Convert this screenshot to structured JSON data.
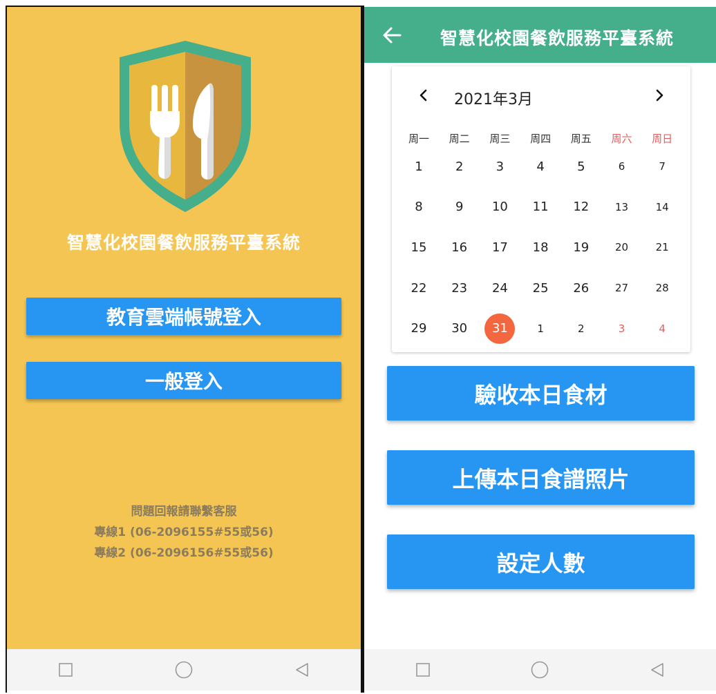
{
  "left_screen": {
    "app_title": "智慧化校園餐飲服務平臺系統",
    "buttons": {
      "cloud_login": "教育雲端帳號登入",
      "general_login": "一般登入"
    },
    "support": {
      "line0": "問題回報請聯繫客服",
      "line1": "專線1 (06-2096155#55或56)",
      "line2": "專線2 (06-2096156#55或56)"
    },
    "logo_icon": "shield-fork-knife-logo",
    "colors": {
      "background": "#f4c552",
      "button": "#2796f3",
      "shield": "#45ae8a"
    }
  },
  "right_screen": {
    "app_title": "智慧化校園餐飲服務平臺系統",
    "back_icon": "arrow-left-icon",
    "calendar": {
      "month_label": "2021年3月",
      "weekdays": [
        "周一",
        "周二",
        "周三",
        "周四",
        "周五",
        "周六",
        "周日"
      ],
      "weeks": [
        [
          "1",
          "2",
          "3",
          "4",
          "5",
          "6",
          "7"
        ],
        [
          "8",
          "9",
          "10",
          "11",
          "12",
          "13",
          "14"
        ],
        [
          "15",
          "16",
          "17",
          "18",
          "19",
          "20",
          "21"
        ],
        [
          "22",
          "23",
          "24",
          "25",
          "26",
          "27",
          "28"
        ],
        [
          "29",
          "30",
          "31",
          "1",
          "2",
          "3",
          "4"
        ]
      ],
      "selected_day": "31",
      "colors": {
        "selected": "#f2673f",
        "weekend": "#e85b5b"
      }
    },
    "buttons": {
      "inspect": "驗收本日食材",
      "upload": "上傳本日食譜照片",
      "set_count": "設定人數"
    },
    "colors": {
      "app_bar": "#45ae8a",
      "button": "#2796f3"
    }
  },
  "navbar": {
    "icons": [
      "square-icon",
      "circle-icon",
      "triangle-back-icon"
    ]
  }
}
